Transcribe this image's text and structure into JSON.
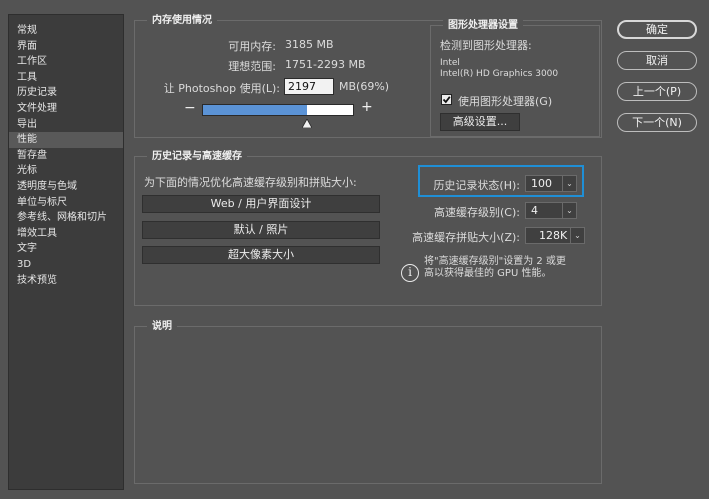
{
  "sidebar": {
    "items": [
      {
        "label": "常规",
        "active": false
      },
      {
        "label": "界面",
        "active": false
      },
      {
        "label": "工作区",
        "active": false
      },
      {
        "label": "工具",
        "active": false
      },
      {
        "label": "历史记录",
        "active": false
      },
      {
        "label": "文件处理",
        "active": false
      },
      {
        "label": "导出",
        "active": false
      },
      {
        "label": "性能",
        "active": true
      },
      {
        "label": "暂存盘",
        "active": false
      },
      {
        "label": "光标",
        "active": false
      },
      {
        "label": "透明度与色域",
        "active": false
      },
      {
        "label": "单位与标尺",
        "active": false
      },
      {
        "label": "参考线、网格和切片",
        "active": false
      },
      {
        "label": "增效工具",
        "active": false
      },
      {
        "label": "文字",
        "active": false
      },
      {
        "label": "3D",
        "active": false
      },
      {
        "label": "技术预览",
        "active": false
      }
    ]
  },
  "memory": {
    "title": "内存使用情况",
    "available_label": "可用内存:",
    "available_value": "3185 MB",
    "ideal_label": "理想范围:",
    "ideal_value": "1751-2293 MB",
    "let_label": "让 Photoshop 使用(L):",
    "let_value": "2197",
    "let_unit": "MB(69%)",
    "minus": "−",
    "plus": "+",
    "slider_fraction": 0.69
  },
  "gpu": {
    "title": "图形处理器设置",
    "detected_label": "检测到图形处理器:",
    "vendor": "Intel",
    "model": "Intel(R) HD Graphics 3000",
    "use_gpu_label": "使用图形处理器(G)",
    "use_gpu_checked": true,
    "advanced_button": "高级设置..."
  },
  "history_cache": {
    "title": "历史记录与高速缓存",
    "optimize_label": "为下面的情况优化高速缓存级别和拼贴大小:",
    "btn_web": "Web / 用户界面设计",
    "btn_default": "默认 / 照片",
    "btn_huge": "超大像素大小",
    "history_states_label": "历史记录状态(H):",
    "history_states_value": "100",
    "cache_levels_label": "高速缓存级别(C):",
    "cache_levels_value": "4",
    "cache_tile_label": "高速缓存拼贴大小(Z):",
    "cache_tile_value": "128K",
    "info_line1": "将\"高速缓存级别\"设置为 2 或更",
    "info_line2": "高以获得最佳的 GPU 性能。"
  },
  "description": {
    "title": "说明"
  },
  "buttons": {
    "ok": "确定",
    "cancel": "取消",
    "prev": "上一个(P)",
    "next": "下一个(N)"
  }
}
